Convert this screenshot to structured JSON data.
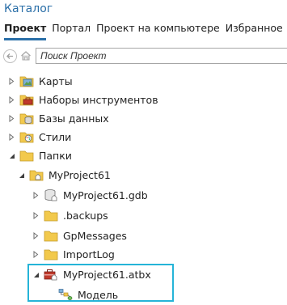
{
  "pane": {
    "title": "Каталог"
  },
  "tabs": [
    {
      "label": "Проект",
      "active": true
    },
    {
      "label": "Портал",
      "active": false
    },
    {
      "label": "Проект на компьютере",
      "active": false
    },
    {
      "label": "Избранное",
      "active": false
    }
  ],
  "search": {
    "placeholder": "Поиск Проект",
    "value": ""
  },
  "tree": {
    "maps": "Карты",
    "toolboxes": "Наборы инструментов",
    "databases": "Базы данных",
    "styles": "Стили",
    "folders": "Папки",
    "project_folder": "MyProject61",
    "gdb": "MyProject61.gdb",
    "backups": ".backups",
    "gpmessages": "GpMessages",
    "importlog": "ImportLog",
    "atbx": "MyProject61.atbx",
    "model": "Модель"
  },
  "colors": {
    "accent": "#2b6fa8",
    "highlight": "#25b4d8",
    "folder": "#f2c94c"
  }
}
